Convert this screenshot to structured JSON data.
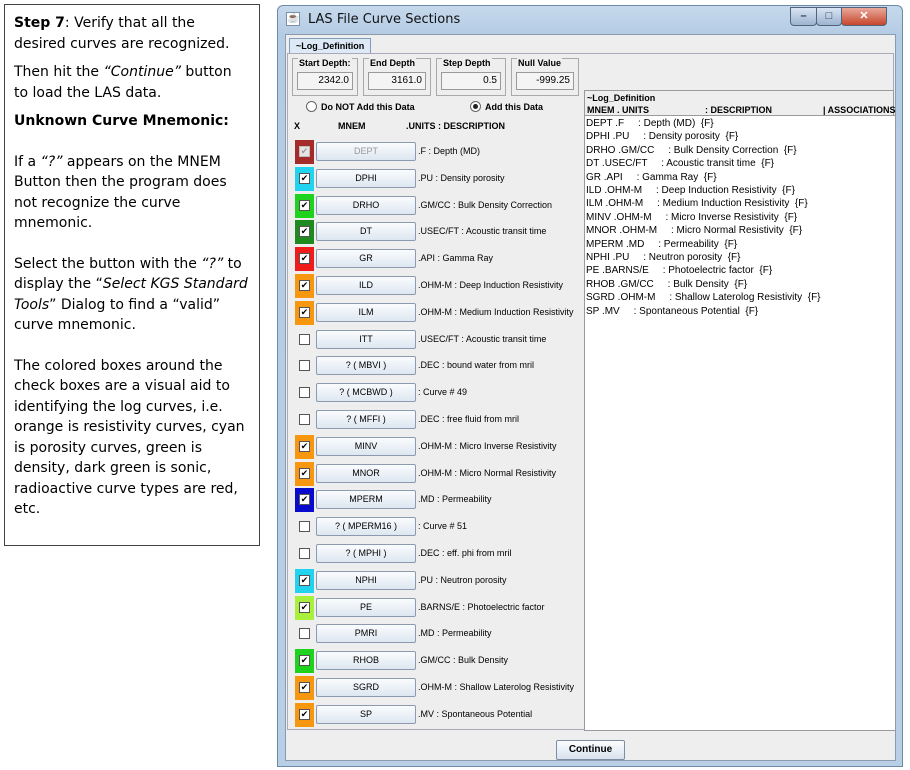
{
  "instructions": {
    "step_label": "Step 7",
    "step_text": ": Verify that all the desired curves are recognized.",
    "p2_pre": "Then hit the ",
    "p2_em": "“Continue”",
    "p2_post": " button to load the LAS data.",
    "heading": "Unknown Curve Mnemonic:",
    "p3_pre": "If a ",
    "p3_em": "“?”",
    "p3_post": " appears on the MNEM Button then the program does not recognize the curve mnemonic.",
    "p4_pre": "Select the button with the ",
    "p4_em1": "“?”",
    "p4_mid": " to display the “",
    "p4_em2": "Select KGS Standard Tools",
    "p4_post": "” Dialog to find a “valid” curve mnemonic.",
    "p5": "The colored boxes around the check boxes are a visual aid to identifying the log curves, i.e. orange is resistivity curves, cyan is porosity curves, green is density, dark green is sonic, radioactive curve types are red, etc."
  },
  "window": {
    "title": "LAS File Curve Sections",
    "app_icon": "☕",
    "min_glyph": "–",
    "max_glyph": "□",
    "close_glyph": "✕",
    "tab": "~Log_Definition",
    "start_depth_label": "Start Depth:",
    "start_depth": "2342.0",
    "end_depth_label": "End Depth",
    "end_depth": "3161.0",
    "step_depth_label": "Step Depth",
    "step_depth": "0.5",
    "null_value_label": "Null Value",
    "null_value": "-999.25",
    "radio_not_add": "Do NOT Add this Data",
    "radio_add": "Add this Data",
    "col_x": "X",
    "col_mnem": "MNEM",
    "col_units_desc": ".UNITS  : DESCRIPTION",
    "continue": "Continue"
  },
  "curves": [
    {
      "mnem": "DEPT",
      "desc": ".F : Depth (MD)",
      "checked": true,
      "color": "#a52a2a",
      "disabled": true
    },
    {
      "mnem": "DPHI",
      "desc": ".PU : Density porosity",
      "checked": true,
      "color": "#22d3f0",
      "disabled": false
    },
    {
      "mnem": "DRHO",
      "desc": ".GM/CC : Bulk Density Correction",
      "checked": true,
      "color": "#1ed21e",
      "disabled": false
    },
    {
      "mnem": "DT",
      "desc": ".USEC/FT : Acoustic transit time",
      "checked": true,
      "color": "#1f8a1f",
      "disabled": false
    },
    {
      "mnem": "GR",
      "desc": ".API : Gamma Ray",
      "checked": true,
      "color": "#ef1c1c",
      "disabled": false
    },
    {
      "mnem": "ILD",
      "desc": ".OHM-M : Deep Induction Resistivity",
      "checked": true,
      "color": "#f7960f",
      "disabled": false
    },
    {
      "mnem": "ILM",
      "desc": ".OHM-M : Medium Induction Resistivity",
      "checked": true,
      "color": "#f7960f",
      "disabled": false
    },
    {
      "mnem": "ITT",
      "desc": ".USEC/FT : Acoustic transit time",
      "checked": false,
      "color": "",
      "disabled": false
    },
    {
      "mnem": "? ( MBVI )",
      "desc": ".DEC : bound water from mril",
      "checked": false,
      "color": "",
      "disabled": false
    },
    {
      "mnem": "? ( MCBWD )",
      "desc": ": Curve #  49",
      "checked": false,
      "color": "",
      "disabled": false
    },
    {
      "mnem": "? ( MFFI )",
      "desc": ".DEC : free fluid from mril",
      "checked": false,
      "color": "",
      "disabled": false
    },
    {
      "mnem": "MINV",
      "desc": ".OHM-M : Micro Inverse Resistivity",
      "checked": true,
      "color": "#f7960f",
      "disabled": false
    },
    {
      "mnem": "MNOR",
      "desc": ".OHM-M : Micro Normal Resistivity",
      "checked": true,
      "color": "#f7960f",
      "disabled": false
    },
    {
      "mnem": "MPERM",
      "desc": ".MD : Permeability",
      "checked": true,
      "color": "#0a0acd",
      "disabled": false
    },
    {
      "mnem": "? ( MPERM16 )",
      "desc": ": Curve #  51",
      "checked": false,
      "color": "",
      "disabled": false
    },
    {
      "mnem": "? ( MPHI )",
      "desc": ".DEC : eff. phi from mril",
      "checked": false,
      "color": "",
      "disabled": false
    },
    {
      "mnem": "NPHI",
      "desc": ".PU : Neutron porosity",
      "checked": true,
      "color": "#22d3f0",
      "disabled": false
    },
    {
      "mnem": "PE",
      "desc": ".BARNS/E : Photoelectric factor",
      "checked": true,
      "color": "#a8f03c",
      "disabled": false
    },
    {
      "mnem": "PMRI",
      "desc": ".MD : Permeability",
      "checked": false,
      "color": "",
      "disabled": false
    },
    {
      "mnem": "RHOB",
      "desc": ".GM/CC : Bulk Density",
      "checked": true,
      "color": "#1ed21e",
      "disabled": false
    },
    {
      "mnem": "SGRD",
      "desc": ".OHM-M : Shallow Laterolog Resistivity",
      "checked": true,
      "color": "#f7960f",
      "disabled": false
    },
    {
      "mnem": "SP",
      "desc": ".MV : Spontaneous Potential",
      "checked": true,
      "color": "#f7960f",
      "disabled": false
    }
  ],
  "right_panel": {
    "title": "~Log_Definition",
    "hdr_mnem": "MNEM . UNITS",
    "hdr_desc": ": DESCRIPTION",
    "hdr_assoc": "| ASSOCIATIONS",
    "lines": [
      "DEPT .F     : Depth (MD)  {F}",
      "DPHI .PU     : Density porosity  {F}",
      "DRHO .GM/CC     : Bulk Density Correction  {F}",
      "DT .USEC/FT     : Acoustic transit time  {F}",
      "GR .API     : Gamma Ray  {F}",
      "ILD .OHM-M     : Deep Induction Resistivity  {F}",
      "ILM .OHM-M     : Medium Induction Resistivity  {F}",
      "MINV .OHM-M     : Micro Inverse Resistivity  {F}",
      "MNOR .OHM-M     : Micro Normal Resistivity  {F}",
      "MPERM .MD     : Permeability  {F}",
      "NPHI .PU     : Neutron porosity  {F}",
      "PE .BARNS/E     : Photoelectric factor  {F}",
      "RHOB .GM/CC     : Bulk Density  {F}",
      "SGRD .OHM-M     : Shallow Laterolog Resistivity  {F}",
      "SP .MV     : Spontaneous Potential  {F}"
    ]
  }
}
